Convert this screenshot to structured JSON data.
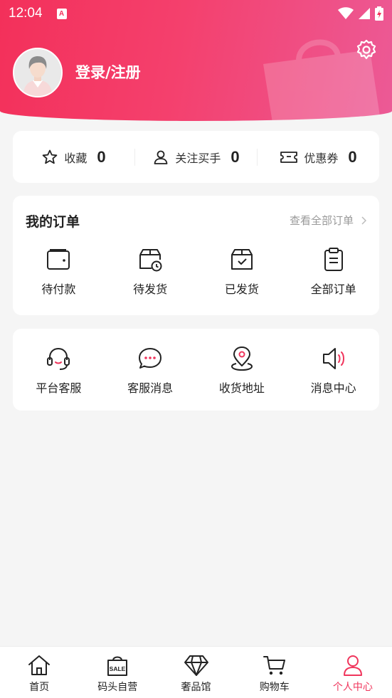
{
  "status_bar": {
    "time": "12:04",
    "notification_icon": "A"
  },
  "header": {
    "login_label": "登录/注册",
    "accent_color": "#f3305a",
    "settings_icon": "gear-icon",
    "avatar_icon": "avatar"
  },
  "stats": [
    {
      "icon": "star-icon",
      "label": "收藏",
      "value": "0"
    },
    {
      "icon": "person-icon",
      "label": "关注买手",
      "value": "0"
    },
    {
      "icon": "ticket-icon",
      "label": "优惠券",
      "value": "0"
    }
  ],
  "orders": {
    "title": "我的订单",
    "view_all": "查看全部订单",
    "items": [
      {
        "icon": "wallet-icon",
        "label": "待付款"
      },
      {
        "icon": "box-clock-icon",
        "label": "待发货"
      },
      {
        "icon": "box-check-icon",
        "label": "已发货"
      },
      {
        "icon": "clipboard-icon",
        "label": "全部订单"
      }
    ]
  },
  "services": {
    "items": [
      {
        "icon": "headset-icon",
        "label": "平台客服"
      },
      {
        "icon": "chat-bubble-icon",
        "label": "客服消息"
      },
      {
        "icon": "location-pin-icon",
        "label": "收货地址"
      },
      {
        "icon": "speaker-icon",
        "label": "消息中心"
      }
    ]
  },
  "tabbar": {
    "active_color": "#f0355c",
    "items": [
      {
        "icon": "home-icon",
        "label": "首页"
      },
      {
        "icon": "sale-bag-icon",
        "label": "码头自营",
        "badge": "SALE"
      },
      {
        "icon": "diamond-icon",
        "label": "奢品馆"
      },
      {
        "icon": "cart-icon",
        "label": "购物车"
      },
      {
        "icon": "user-icon",
        "label": "个人中心",
        "active": true
      }
    ]
  }
}
